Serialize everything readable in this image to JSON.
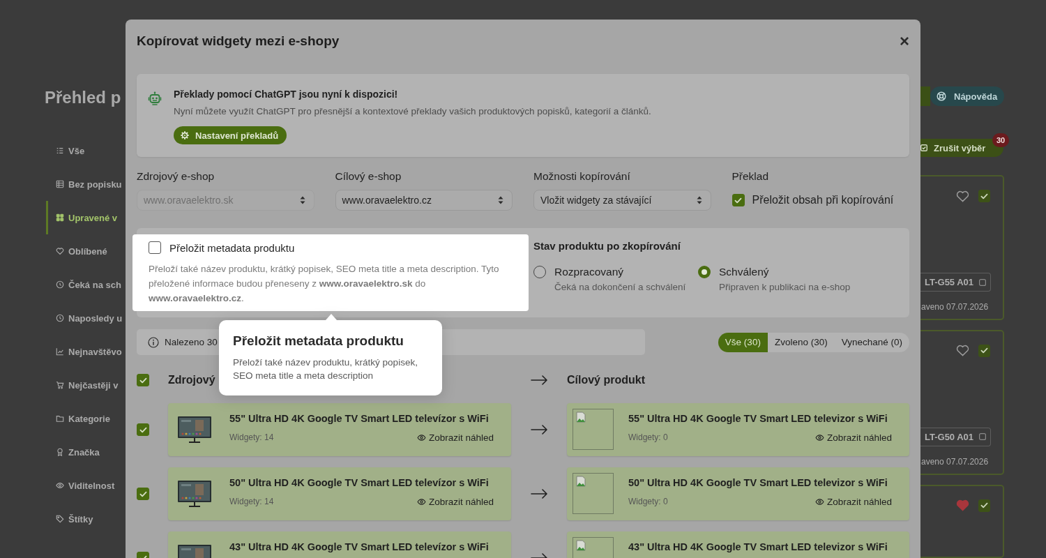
{
  "background": {
    "page_title": "Přehled p",
    "sidebar": {
      "items": [
        {
          "label": "Vše",
          "selected": false
        },
        {
          "label": "Bez popisku",
          "selected": false
        },
        {
          "label": "Upravené v",
          "selected": true
        },
        {
          "label": "Oblíbené",
          "selected": false
        },
        {
          "label": "Čeká na sch",
          "selected": false
        },
        {
          "label": "Naposledy u",
          "selected": false
        },
        {
          "label": "Nejnavštěvo",
          "selected": false
        },
        {
          "label": "Nejčastěji v",
          "selected": false
        },
        {
          "label": "Kategorie",
          "selected": false
        },
        {
          "label": "Značka",
          "selected": false
        },
        {
          "label": "Viditelnost",
          "selected": false
        },
        {
          "label": "Štítky",
          "selected": false
        }
      ]
    },
    "help_button": "Nápověda",
    "clear_selection": {
      "label": "Zrušit výběr",
      "badge": "30"
    },
    "product_cards": [
      {
        "code": "LT-G55 A01",
        "date": "aveno 07.07.2026",
        "favorite": false,
        "checked": true
      },
      {
        "code": "LT-G50 A01",
        "date": "aveno 07.07.2026",
        "favorite": false,
        "checked": true
      },
      {
        "favorite": true,
        "checked": true
      }
    ]
  },
  "dialog": {
    "title": "Kopírovat widgety mezi e-shopy",
    "close": "×",
    "notice": {
      "title": "Překlady pomocí ChatGPT jsou nyní k dispozici!",
      "text": "Nyní můžete využít ChatGPT pro přesnější a kontextové překlady vašich produktových popisků, kategorií a článků.",
      "button": "Nastavení překladů"
    },
    "fields": [
      {
        "kind": "select",
        "label": "Zdrojový e-shop",
        "value": "www.oravaelektro.sk",
        "disabled": true
      },
      {
        "kind": "select",
        "label": "Cílový e-shop",
        "value": "www.oravaelektro.cz",
        "disabled": false
      },
      {
        "kind": "select",
        "label": "Možnosti kopírování",
        "value": "Vložit widgety za stávající",
        "disabled": false
      },
      {
        "kind": "checkbox",
        "label": "Překlad",
        "option": "Přeložit obsah při kopírování",
        "checked": true
      }
    ],
    "metadata_option": {
      "label": "Přeložit metadata produktu",
      "checked": false,
      "highlighted": true,
      "text": "Přeloží také název produktu, krátký popisek, SEO meta title a meta description. Tyto přeložené informace budou přeneseny z **www.oravaelektro.sk** do **www.oravaelektro.cz**."
    },
    "status": {
      "title": "Stav produktu po zkopírování",
      "options": [
        {
          "label": "Rozpracovaný",
          "hint": "Čeká na dokončení a schválení",
          "selected": false
        },
        {
          "label": "Schválený",
          "hint": "Připraven k publikaci na e-shop",
          "selected": true
        }
      ]
    },
    "results": "Nalezeno 30",
    "filters": [
      {
        "label": "Vše (30)",
        "selected": true
      },
      {
        "label": "Zvoleno (30)",
        "selected": false
      },
      {
        "label": "Vynechané (0)",
        "selected": false
      }
    ],
    "columns": {
      "all_checked": true,
      "source": "Zdrojový",
      "target": "Cílový produkt"
    },
    "rows": [
      {
        "checked": true,
        "source": {
          "title": "55\" Ultra HD 4K Google TV Smart LED televízor s WiFi",
          "widgets": "Widgety: 14",
          "preview": "Zobrazit náhled"
        },
        "target": {
          "title": "55\" Ultra HD 4K Google TV Smart LED televizor s WiFi",
          "widgets": "Widgety: 0",
          "preview": "Zobrazit náhled"
        }
      },
      {
        "checked": true,
        "source": {
          "title": "50\" Ultra HD 4K Google TV Smart LED televízor s WiFi",
          "widgets": "Widgety: 14",
          "preview": "Zobrazit náhled"
        },
        "target": {
          "title": "50\" Ultra HD 4K Google TV Smart LED televizor s WiFi",
          "widgets": "Widgety: 0",
          "preview": "Zobrazit náhled"
        }
      },
      {
        "checked": true,
        "source": {
          "title": "43\" Ultra HD 4K Google TV Smart LED televízor s WiFi"
        },
        "target": {
          "title": "43\" Ultra HD 4K Google TV Smart LED televizor s WiFi"
        }
      }
    ]
  },
  "tour_tooltip": {
    "title": "Přeložit metadata produktu",
    "text": "Přeloží také název produktu, krátký popisek, SEO meta title a meta description"
  }
}
